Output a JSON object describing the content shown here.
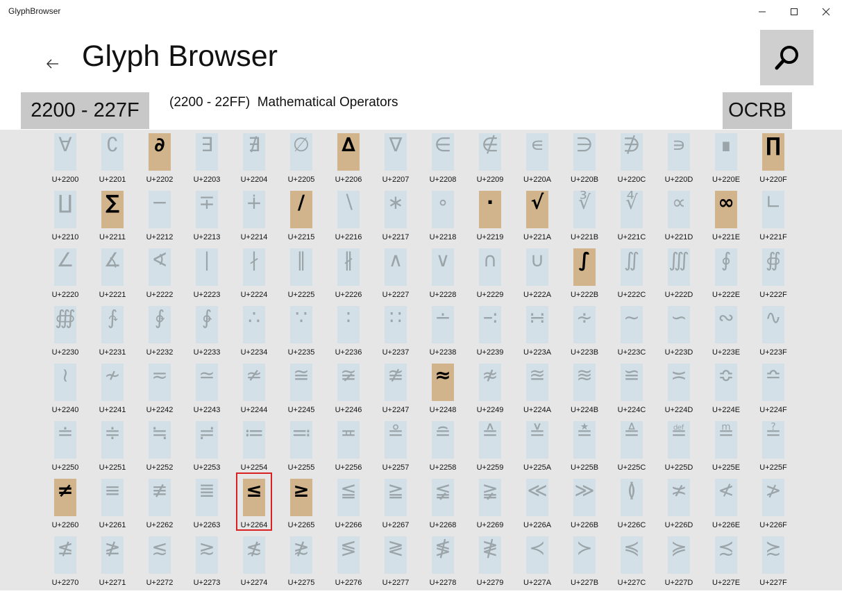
{
  "window": {
    "title": "GlyphBrowser",
    "minimize_icon": "minimize-icon",
    "maximize_icon": "maximize-icon",
    "close_icon": "close-icon"
  },
  "header": {
    "page_title": "Glyph Browser",
    "back_icon": "back-arrow-icon",
    "search_icon": "search-icon",
    "range_label": "2200 - 227F",
    "range_description": "(2200 - 22FF)  Mathematical Operators",
    "font_label": "OCRB"
  },
  "colors": {
    "tile": "#d3e0e7",
    "tile_highlight": "#d2b48c",
    "selection_border": "#d82020",
    "grid_background": "#e6e6e6"
  },
  "selected_code": "U+2264",
  "glyphs": [
    {
      "char": "∀",
      "code": "U+2200",
      "hl": false
    },
    {
      "char": "∁",
      "code": "U+2201",
      "hl": false
    },
    {
      "char": "∂",
      "code": "U+2202",
      "hl": true
    },
    {
      "char": "∃",
      "code": "U+2203",
      "hl": false
    },
    {
      "char": "∄",
      "code": "U+2204",
      "hl": false
    },
    {
      "char": "∅",
      "code": "U+2205",
      "hl": false
    },
    {
      "char": "∆",
      "code": "U+2206",
      "hl": true
    },
    {
      "char": "∇",
      "code": "U+2207",
      "hl": false
    },
    {
      "char": "∈",
      "code": "U+2208",
      "hl": false
    },
    {
      "char": "∉",
      "code": "U+2209",
      "hl": false
    },
    {
      "char": "∊",
      "code": "U+220A",
      "hl": false
    },
    {
      "char": "∋",
      "code": "U+220B",
      "hl": false
    },
    {
      "char": "∌",
      "code": "U+220C",
      "hl": false
    },
    {
      "char": "∍",
      "code": "U+220D",
      "hl": false
    },
    {
      "char": "∎",
      "code": "U+220E",
      "hl": false
    },
    {
      "char": "∏",
      "code": "U+220F",
      "hl": true
    },
    {
      "char": "∐",
      "code": "U+2210",
      "hl": false
    },
    {
      "char": "∑",
      "code": "U+2211",
      "hl": true
    },
    {
      "char": "−",
      "code": "U+2212",
      "hl": false
    },
    {
      "char": "∓",
      "code": "U+2213",
      "hl": false
    },
    {
      "char": "∔",
      "code": "U+2214",
      "hl": false
    },
    {
      "char": "∕",
      "code": "U+2215",
      "hl": true
    },
    {
      "char": "∖",
      "code": "U+2216",
      "hl": false
    },
    {
      "char": "∗",
      "code": "U+2217",
      "hl": false
    },
    {
      "char": "∘",
      "code": "U+2218",
      "hl": false
    },
    {
      "char": "∙",
      "code": "U+2219",
      "hl": true
    },
    {
      "char": "√",
      "code": "U+221A",
      "hl": true
    },
    {
      "char": "∛",
      "code": "U+221B",
      "hl": false
    },
    {
      "char": "∜",
      "code": "U+221C",
      "hl": false
    },
    {
      "char": "∝",
      "code": "U+221D",
      "hl": false
    },
    {
      "char": "∞",
      "code": "U+221E",
      "hl": true
    },
    {
      "char": "∟",
      "code": "U+221F",
      "hl": false
    },
    {
      "char": "∠",
      "code": "U+2220",
      "hl": false
    },
    {
      "char": "∡",
      "code": "U+2221",
      "hl": false
    },
    {
      "char": "∢",
      "code": "U+2222",
      "hl": false
    },
    {
      "char": "∣",
      "code": "U+2223",
      "hl": false
    },
    {
      "char": "∤",
      "code": "U+2224",
      "hl": false
    },
    {
      "char": "∥",
      "code": "U+2225",
      "hl": false
    },
    {
      "char": "∦",
      "code": "U+2226",
      "hl": false
    },
    {
      "char": "∧",
      "code": "U+2227",
      "hl": false
    },
    {
      "char": "∨",
      "code": "U+2228",
      "hl": false
    },
    {
      "char": "∩",
      "code": "U+2229",
      "hl": false
    },
    {
      "char": "∪",
      "code": "U+222A",
      "hl": false
    },
    {
      "char": "∫",
      "code": "U+222B",
      "hl": true
    },
    {
      "char": "∬",
      "code": "U+222C",
      "hl": false
    },
    {
      "char": "∭",
      "code": "U+222D",
      "hl": false
    },
    {
      "char": "∮",
      "code": "U+222E",
      "hl": false
    },
    {
      "char": "∯",
      "code": "U+222F",
      "hl": false
    },
    {
      "char": "∰",
      "code": "U+2230",
      "hl": false
    },
    {
      "char": "∱",
      "code": "U+2231",
      "hl": false
    },
    {
      "char": "∲",
      "code": "U+2232",
      "hl": false
    },
    {
      "char": "∳",
      "code": "U+2233",
      "hl": false
    },
    {
      "char": "∴",
      "code": "U+2234",
      "hl": false
    },
    {
      "char": "∵",
      "code": "U+2235",
      "hl": false
    },
    {
      "char": "∶",
      "code": "U+2236",
      "hl": false
    },
    {
      "char": "∷",
      "code": "U+2237",
      "hl": false
    },
    {
      "char": "∸",
      "code": "U+2238",
      "hl": false
    },
    {
      "char": "∹",
      "code": "U+2239",
      "hl": false
    },
    {
      "char": "∺",
      "code": "U+223A",
      "hl": false
    },
    {
      "char": "∻",
      "code": "U+223B",
      "hl": false
    },
    {
      "char": "∼",
      "code": "U+223C",
      "hl": false
    },
    {
      "char": "∽",
      "code": "U+223D",
      "hl": false
    },
    {
      "char": "∾",
      "code": "U+223E",
      "hl": false
    },
    {
      "char": "∿",
      "code": "U+223F",
      "hl": false
    },
    {
      "char": "≀",
      "code": "U+2240",
      "hl": false
    },
    {
      "char": "≁",
      "code": "U+2241",
      "hl": false
    },
    {
      "char": "≂",
      "code": "U+2242",
      "hl": false
    },
    {
      "char": "≃",
      "code": "U+2243",
      "hl": false
    },
    {
      "char": "≄",
      "code": "U+2244",
      "hl": false
    },
    {
      "char": "≅",
      "code": "U+2245",
      "hl": false
    },
    {
      "char": "≆",
      "code": "U+2246",
      "hl": false
    },
    {
      "char": "≇",
      "code": "U+2247",
      "hl": false
    },
    {
      "char": "≈",
      "code": "U+2248",
      "hl": true
    },
    {
      "char": "≉",
      "code": "U+2249",
      "hl": false
    },
    {
      "char": "≊",
      "code": "U+224A",
      "hl": false
    },
    {
      "char": "≋",
      "code": "U+224B",
      "hl": false
    },
    {
      "char": "≌",
      "code": "U+224C",
      "hl": false
    },
    {
      "char": "≍",
      "code": "U+224D",
      "hl": false
    },
    {
      "char": "≎",
      "code": "U+224E",
      "hl": false
    },
    {
      "char": "≏",
      "code": "U+224F",
      "hl": false
    },
    {
      "char": "≐",
      "code": "U+2250",
      "hl": false
    },
    {
      "char": "≑",
      "code": "U+2251",
      "hl": false
    },
    {
      "char": "≒",
      "code": "U+2252",
      "hl": false
    },
    {
      "char": "≓",
      "code": "U+2253",
      "hl": false
    },
    {
      "char": "≔",
      "code": "U+2254",
      "hl": false
    },
    {
      "char": "≕",
      "code": "U+2255",
      "hl": false
    },
    {
      "char": "≖",
      "code": "U+2256",
      "hl": false
    },
    {
      "char": "≗",
      "code": "U+2257",
      "hl": false
    },
    {
      "char": "≘",
      "code": "U+2258",
      "hl": false
    },
    {
      "char": "≙",
      "code": "U+2259",
      "hl": false
    },
    {
      "char": "≚",
      "code": "U+225A",
      "hl": false
    },
    {
      "char": "≛",
      "code": "U+225B",
      "hl": false
    },
    {
      "char": "≜",
      "code": "U+225C",
      "hl": false
    },
    {
      "char": "≝",
      "code": "U+225D",
      "hl": false
    },
    {
      "char": "≞",
      "code": "U+225E",
      "hl": false
    },
    {
      "char": "≟",
      "code": "U+225F",
      "hl": false
    },
    {
      "char": "≠",
      "code": "U+2260",
      "hl": true
    },
    {
      "char": "≡",
      "code": "U+2261",
      "hl": false
    },
    {
      "char": "≢",
      "code": "U+2262",
      "hl": false
    },
    {
      "char": "≣",
      "code": "U+2263",
      "hl": false
    },
    {
      "char": "≤",
      "code": "U+2264",
      "hl": true
    },
    {
      "char": "≥",
      "code": "U+2265",
      "hl": true
    },
    {
      "char": "≦",
      "code": "U+2266",
      "hl": false
    },
    {
      "char": "≧",
      "code": "U+2267",
      "hl": false
    },
    {
      "char": "≨",
      "code": "U+2268",
      "hl": false
    },
    {
      "char": "≩",
      "code": "U+2269",
      "hl": false
    },
    {
      "char": "≪",
      "code": "U+226A",
      "hl": false
    },
    {
      "char": "≫",
      "code": "U+226B",
      "hl": false
    },
    {
      "char": "≬",
      "code": "U+226C",
      "hl": false
    },
    {
      "char": "≭",
      "code": "U+226D",
      "hl": false
    },
    {
      "char": "≮",
      "code": "U+226E",
      "hl": false
    },
    {
      "char": "≯",
      "code": "U+226F",
      "hl": false
    },
    {
      "char": "≰",
      "code": "U+2270",
      "hl": false
    },
    {
      "char": "≱",
      "code": "U+2271",
      "hl": false
    },
    {
      "char": "≲",
      "code": "U+2272",
      "hl": false
    },
    {
      "char": "≳",
      "code": "U+2273",
      "hl": false
    },
    {
      "char": "≴",
      "code": "U+2274",
      "hl": false
    },
    {
      "char": "≵",
      "code": "U+2275",
      "hl": false
    },
    {
      "char": "≶",
      "code": "U+2276",
      "hl": false
    },
    {
      "char": "≷",
      "code": "U+2277",
      "hl": false
    },
    {
      "char": "≸",
      "code": "U+2278",
      "hl": false
    },
    {
      "char": "≹",
      "code": "U+2279",
      "hl": false
    },
    {
      "char": "≺",
      "code": "U+227A",
      "hl": false
    },
    {
      "char": "≻",
      "code": "U+227B",
      "hl": false
    },
    {
      "char": "≼",
      "code": "U+227C",
      "hl": false
    },
    {
      "char": "≽",
      "code": "U+227D",
      "hl": false
    },
    {
      "char": "≾",
      "code": "U+227E",
      "hl": false
    },
    {
      "char": "≿",
      "code": "U+227F",
      "hl": false
    }
  ]
}
